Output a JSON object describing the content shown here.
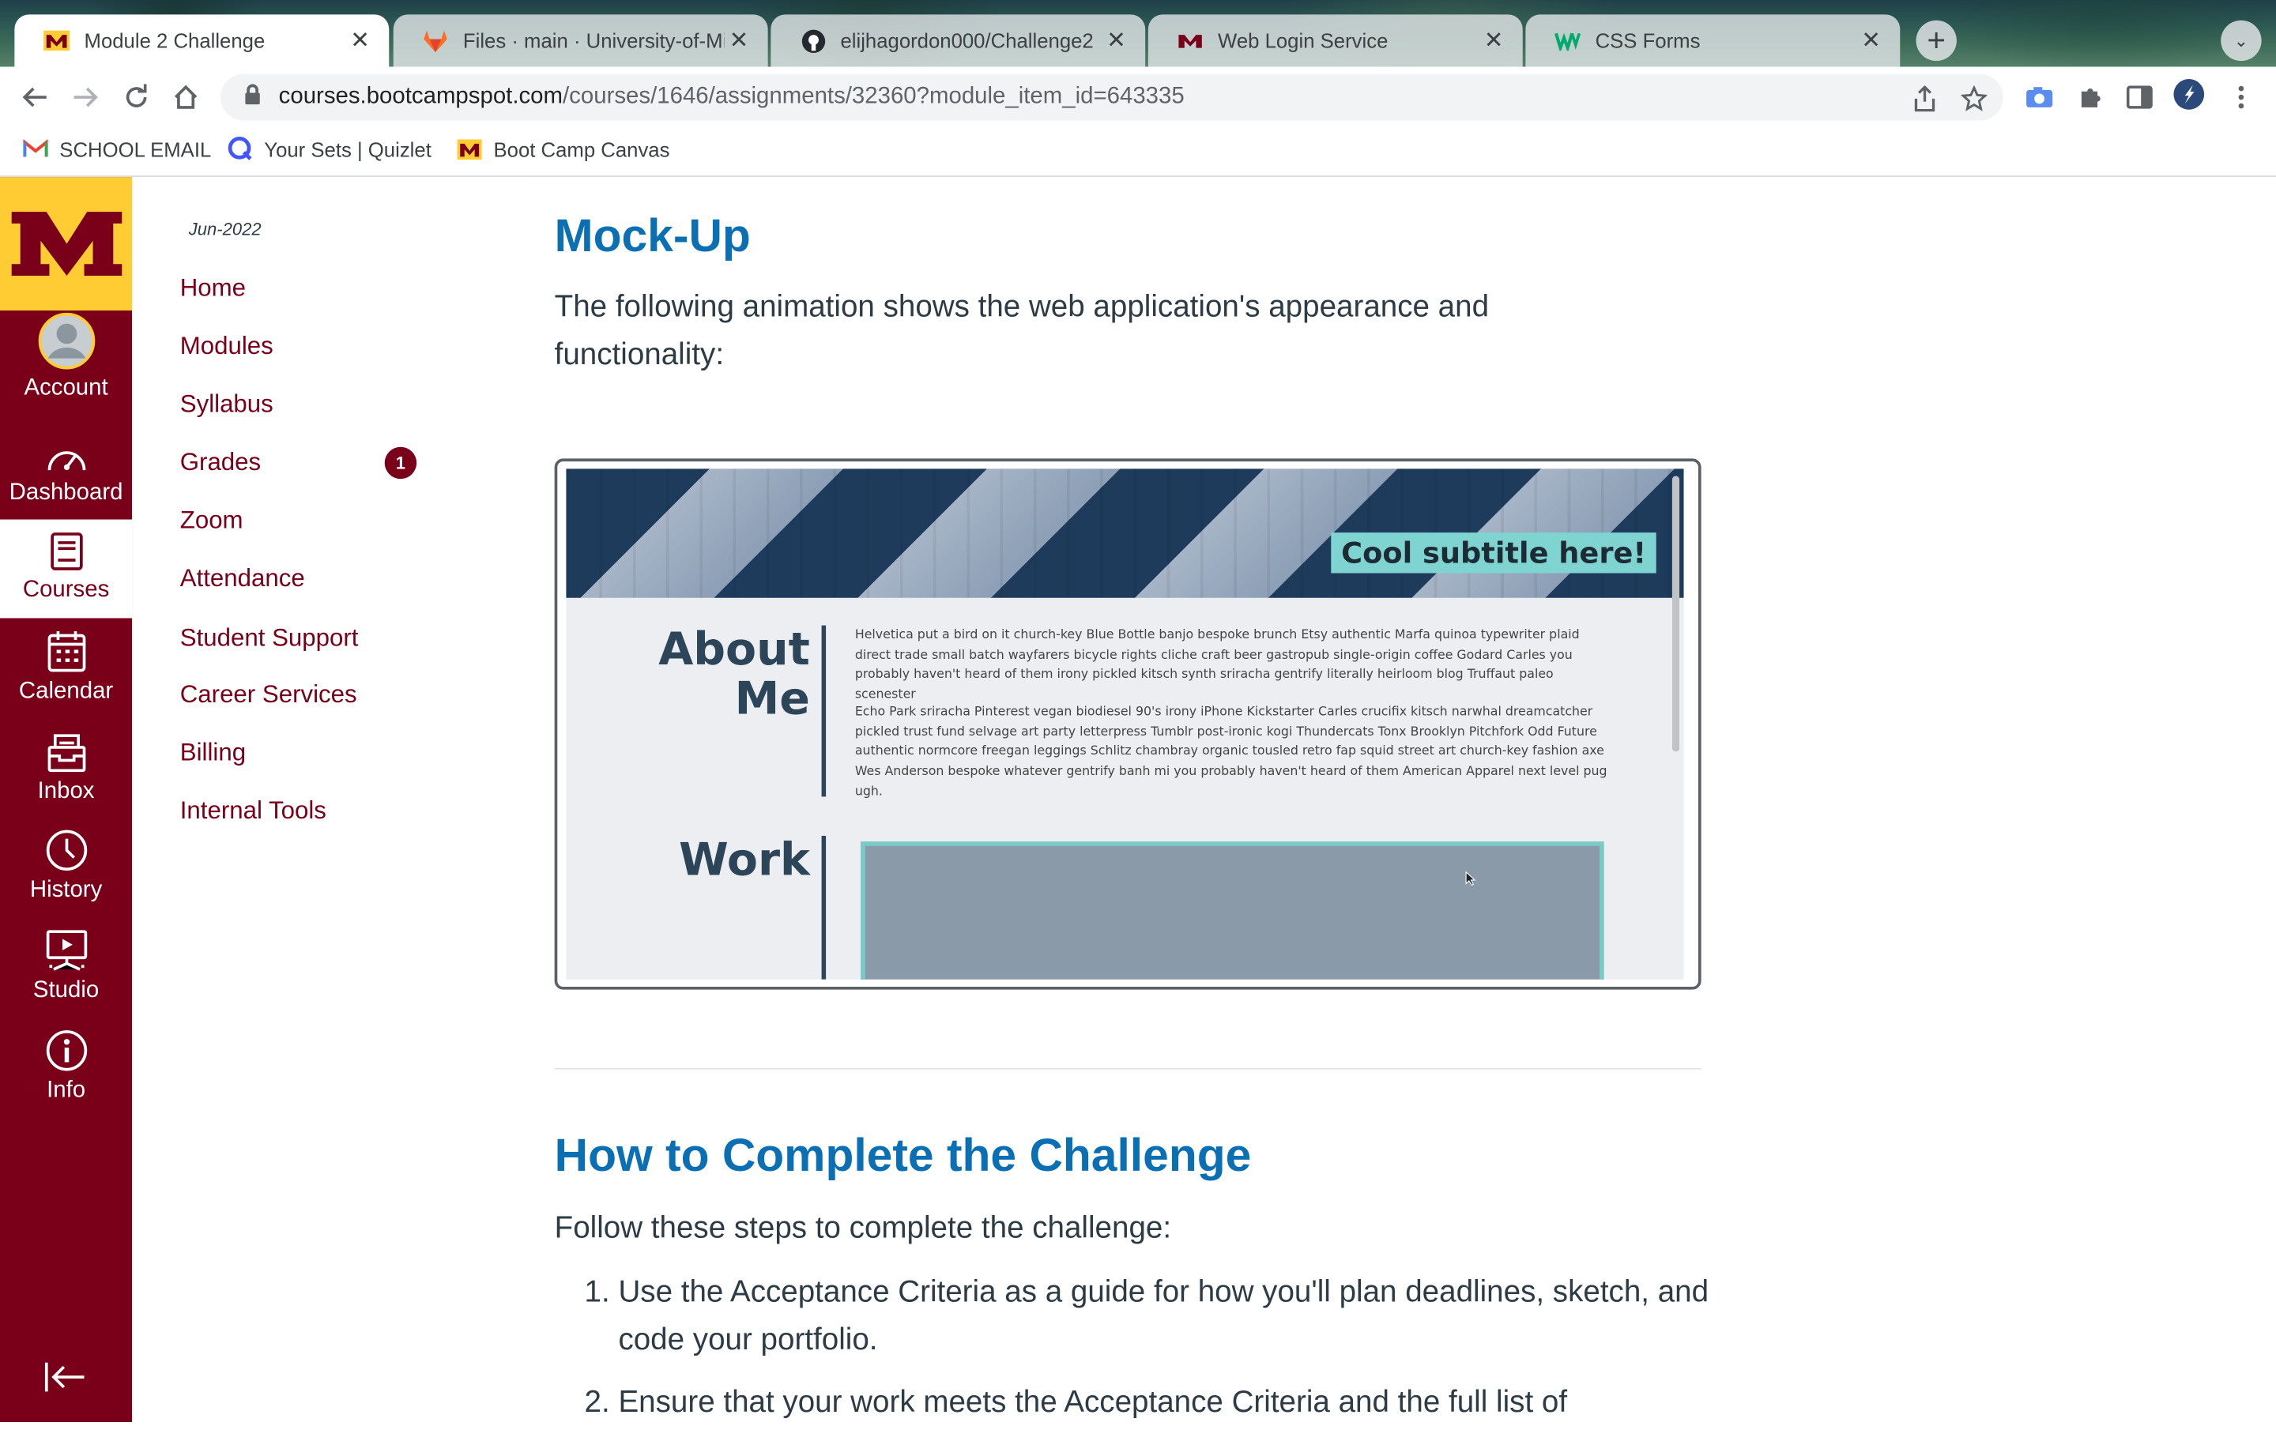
{
  "browser": {
    "tabs": [
      {
        "title": "Module 2 Challenge",
        "icon": "umn-m-icon",
        "active": true
      },
      {
        "title": "Files · main · University-of-Min",
        "icon": "gitlab-icon",
        "active": false
      },
      {
        "title": "elijhagordon000/Challenge2",
        "icon": "github-icon",
        "active": false
      },
      {
        "title": "Web Login Service",
        "icon": "umn-m-icon",
        "active": false
      },
      {
        "title": "CSS Forms",
        "icon": "w3schools-icon",
        "active": false
      }
    ],
    "url_host": "courses.bootcampspot.com",
    "url_path": "/courses/1646/assignments/32360?module_item_id=643335",
    "bookmarks": [
      {
        "label": "SCHOOL EMAIL",
        "icon": "gmail-icon"
      },
      {
        "label": "Your Sets | Quizlet",
        "icon": "quizlet-icon"
      },
      {
        "label": "Boot Camp Canvas",
        "icon": "umn-m-icon"
      }
    ]
  },
  "global_nav": {
    "items": [
      {
        "label": "Account",
        "icon": "avatar-icon"
      },
      {
        "label": "Dashboard",
        "icon": "dashboard-icon"
      },
      {
        "label": "Courses",
        "icon": "courses-icon",
        "active": true
      },
      {
        "label": "Calendar",
        "icon": "calendar-icon"
      },
      {
        "label": "Inbox",
        "icon": "inbox-icon"
      },
      {
        "label": "History",
        "icon": "history-icon"
      },
      {
        "label": "Studio",
        "icon": "studio-icon"
      },
      {
        "label": "Info",
        "icon": "info-icon"
      }
    ],
    "brand_color": "#7a0019",
    "logo_bg": "#ffcc33"
  },
  "course_nav": {
    "term": "Jun-2022",
    "items": [
      "Home",
      "Modules",
      "Syllabus",
      "Grades",
      "Zoom",
      "Attendance",
      "Student Support",
      "Career Services",
      "Billing",
      "Internal Tools"
    ],
    "grades_badge": "1"
  },
  "content": {
    "mockup_heading": "Mock-Up",
    "mockup_intro": "The following animation shows the web application's appearance and functionality:",
    "demo": {
      "subtitle": "Cool subtitle here!",
      "about_title_1": "About",
      "about_title_2": "Me",
      "para1": "Helvetica put a bird on it church-key Blue Bottle banjo bespoke brunch Etsy authentic Marfa quinoa typewriter plaid direct trade small batch wayfarers bicycle rights cliche craft beer gastropub single-origin coffee Godard Carles you probably haven't heard of them irony pickled kitsch synth sriracha gentrify literally heirloom blog Truffaut paleo scenester",
      "para2": "Echo Park sriracha Pinterest vegan biodiesel 90's irony iPhone Kickstarter Carles crucifix kitsch narwhal dreamcatcher pickled trust fund selvage art party letterpress Tumblr post-ironic kogi Thundercats Tonx Brooklyn Pitchfork Odd Future authentic normcore freegan leggings Schlitz chambray organic tousled retro fap squid street art church-key fashion axe Wes Anderson bespoke whatever gentrify banh mi you probably haven't heard of them American Apparel next level pug ugh.",
      "work_title": "Work"
    },
    "howto_heading": "How to Complete the Challenge",
    "howto_intro": "Follow these steps to complete the challenge:",
    "steps": [
      "Use the Acceptance Criteria as a guide for how you'll plan deadlines, sketch, and code your portfolio.",
      "Ensure that your work meets the Acceptance Criteria and the full list of"
    ]
  }
}
